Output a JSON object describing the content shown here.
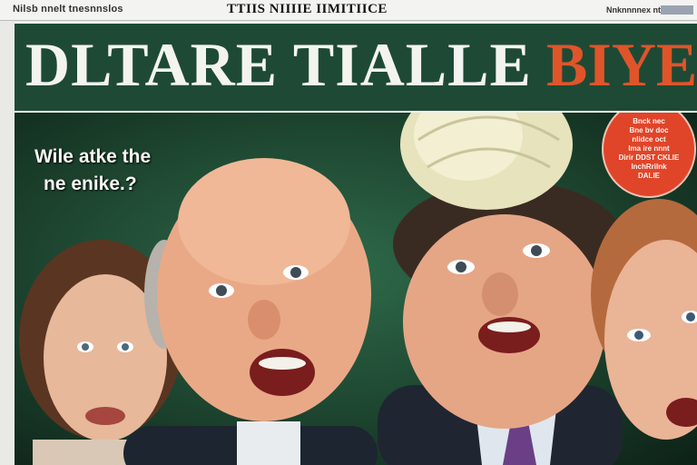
{
  "topbar": {
    "left_text": "Nilsb nnelt tnesnnslos",
    "center_text": "TTIIS NIIIIE IIMITIICE",
    "right_text": "Nnknnnnex ntio"
  },
  "masthead": {
    "title": "DLTARE TIALLE",
    "accent": "BIYE"
  },
  "cover": {
    "headline_line1": "Wile atke the",
    "headline_line2": "ne enike.?",
    "bubble_lines": [
      "Bnck nec",
      "Bne bv doc",
      "nlidce oct",
      "Ima ire nnnt",
      "Dirir DDST CKLIE",
      "InchRriInk",
      "DALIE"
    ]
  },
  "colors": {
    "masthead_bg": "#1e4a35",
    "accent": "#e0542a",
    "bubble": "#e0452a"
  }
}
